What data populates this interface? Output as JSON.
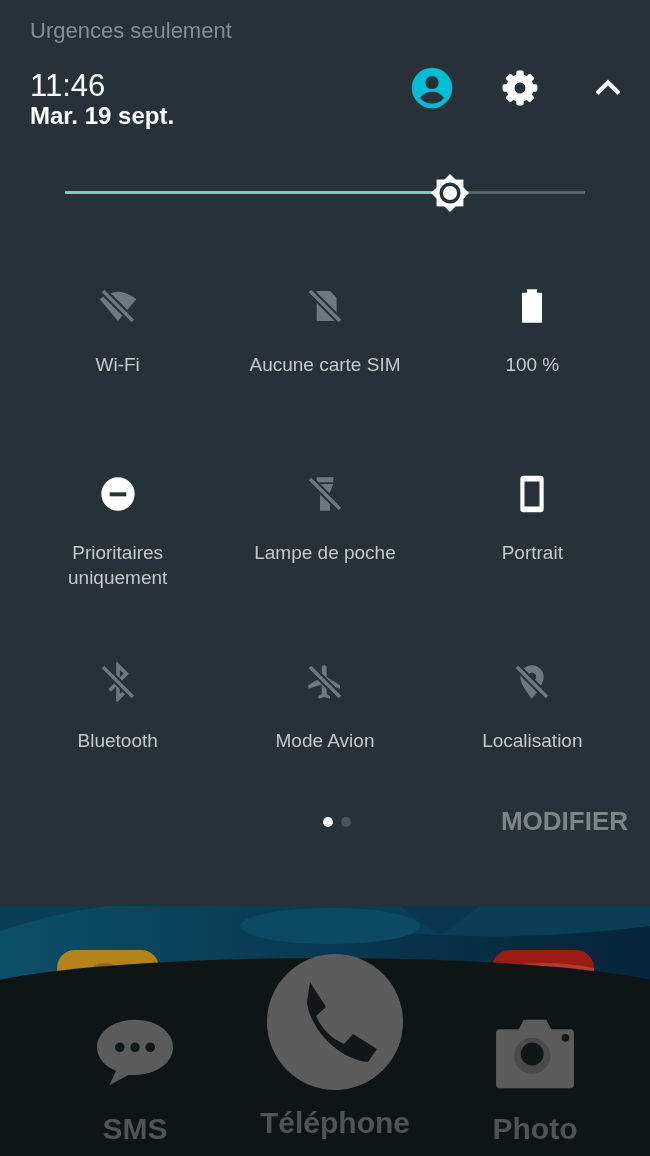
{
  "notice": "Urgences seulement",
  "clock": {
    "time": "11:46",
    "date": "Mar. 19 sept."
  },
  "brightness": {
    "level": 0.74
  },
  "tiles": [
    {
      "label": "Wi-Fi",
      "kind": "wifi",
      "on": false
    },
    {
      "label": "Aucune carte SIM",
      "kind": "sim",
      "on": false
    },
    {
      "label": "100 %",
      "kind": "battery",
      "on": true
    },
    {
      "label": "Prioritaires uniquement",
      "kind": "dnd",
      "on": true
    },
    {
      "label": "Lampe de poche",
      "kind": "flashlight",
      "on": false
    },
    {
      "label": "Portrait",
      "kind": "rotation",
      "on": true
    },
    {
      "label": "Bluetooth",
      "kind": "bluetooth",
      "on": false
    },
    {
      "label": "Mode Avion",
      "kind": "airplane",
      "on": false
    },
    {
      "label": "Localisation",
      "kind": "location",
      "on": false
    }
  ],
  "pages": [
    {
      "selected": true
    },
    {
      "selected": false
    }
  ],
  "edit_button": "MODIFIER",
  "dock": [
    {
      "label": "SMS",
      "kind": "sms"
    },
    {
      "label": "Téléphone",
      "kind": "phone"
    },
    {
      "label": "Photo",
      "kind": "camera"
    }
  ]
}
